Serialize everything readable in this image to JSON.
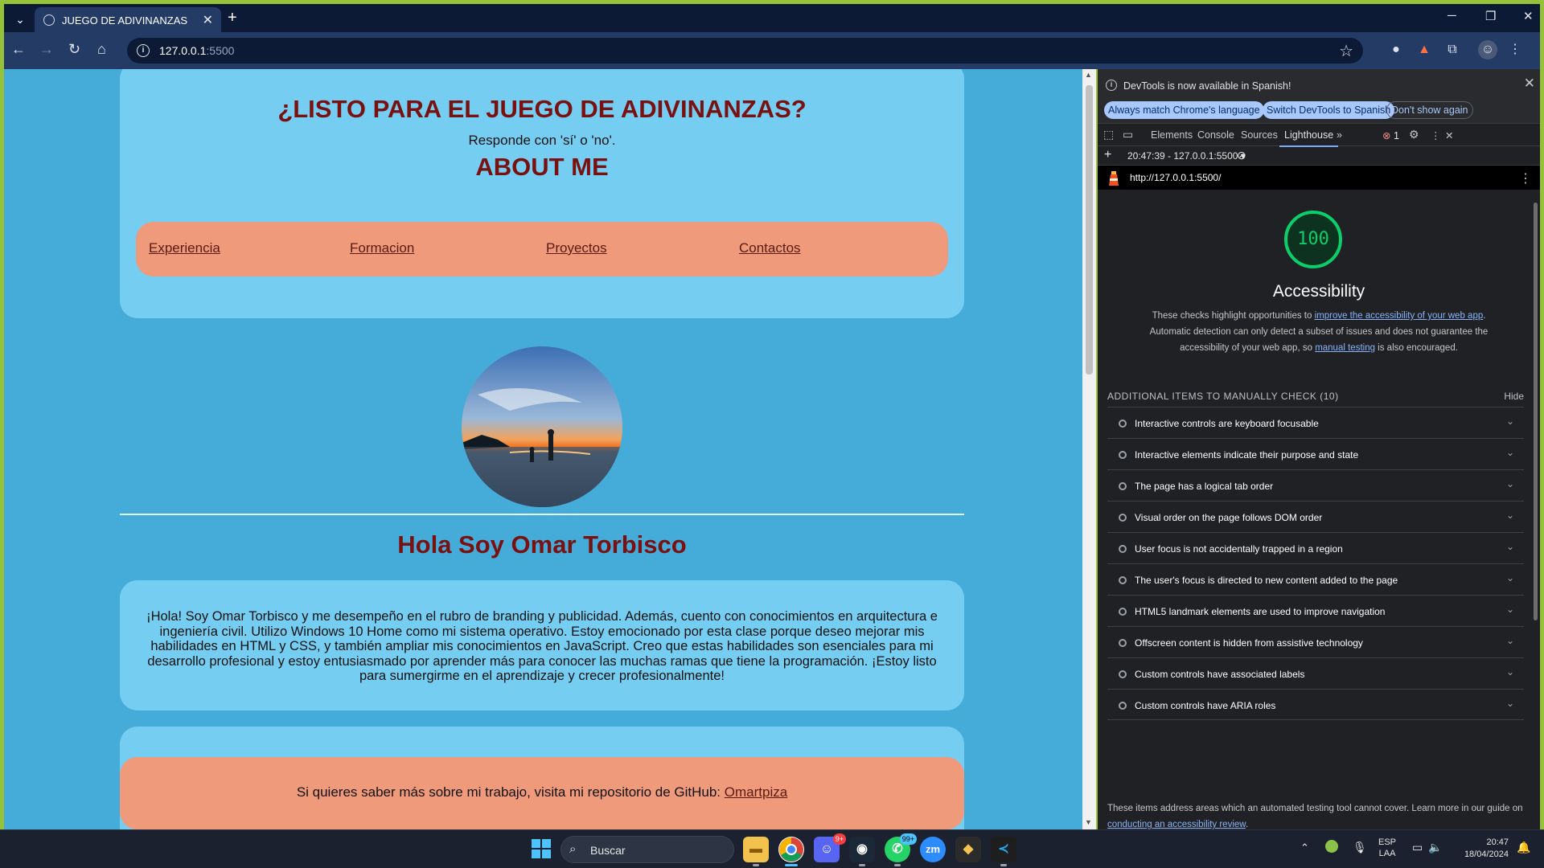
{
  "browser": {
    "tab_title": "JUEGO DE ADIVINANZAS",
    "url_host": "127.0.0.1",
    "url_port": ":5500"
  },
  "page": {
    "title": "¿LISTO PARA EL JUEGO DE ADIVINANZAS?",
    "subtitle": "Responde con 'sí' o 'no'.",
    "about_heading": "ABOUT ME",
    "nav": [
      "Experiencia",
      "Formacion",
      "Proyectos",
      "Contactos"
    ],
    "name_heading": "Hola Soy Omar Torbisco",
    "bio": "¡Hola! Soy Omar Torbisco y me desempeño en el rubro de branding y publicidad. Además, cuento con conocimientos en arquitectura e ingeniería civil. Utilizo Windows 10 Home como mi sistema operativo. Estoy emocionado por esta clase porque deseo mejorar mis habilidades en HTML y CSS, y también ampliar mis conocimientos en JavaScript. Creo que estas habilidades son esenciales para mi desarrollo profesional y estoy entusiasmado por aprender más para conocer las muchas ramas que tiene la programación. ¡Estoy listo para sumergirme en el aprendizaje y crecer profesionalmente!",
    "footer_text": "Si quieres saber más sobre mi trabajo, visita mi repositorio de GitHub: ",
    "footer_link": "Omartpiza"
  },
  "devtools": {
    "banner_text": "DevTools is now available in Spanish!",
    "banner_buttons": [
      "Always match Chrome's language",
      "Switch DevTools to Spanish",
      "Don't show again"
    ],
    "tabs": [
      "Elements",
      "Console",
      "Sources",
      "Lighthouse"
    ],
    "error_count": "1",
    "report_selector": "20:47:39 - 127.0.0.1:5500",
    "report_url": "http://127.0.0.1:5500/",
    "score": "100",
    "category": "Accessibility",
    "desc_1": "These checks highlight opportunities to ",
    "desc_link_1": "improve the accessibility of your web app",
    "desc_2": ". Automatic detection can only detect a subset of issues and does not guarantee the accessibility of your web app, so ",
    "desc_link_2": "manual testing",
    "desc_3": " is also encouraged.",
    "manual_header": "ADDITIONAL ITEMS TO MANUALLY CHECK (10)",
    "hide_label": "Hide",
    "audits": [
      "Interactive controls are keyboard focusable",
      "Interactive elements indicate their purpose and state",
      "The page has a logical tab order",
      "Visual order on the page follows DOM order",
      "User focus is not accidentally trapped in a region",
      "The user's focus is directed to new content added to the page",
      "HTML5 landmark elements are used to improve navigation",
      "Offscreen content is hidden from assistive technology",
      "Custom controls have associated labels",
      "Custom controls have ARIA roles"
    ],
    "footer_1": "These items address areas which an automated testing tool cannot cover. Learn more in our guide on ",
    "footer_link": "conducting an accessibility review",
    "footer_2": "."
  },
  "taskbar": {
    "search_label": "Buscar",
    "discord_badge": "9+",
    "whatsapp_badge": "99+",
    "zoom_label": "zm",
    "lang_1": "ESP",
    "lang_2": "LAA",
    "time": "20:47",
    "date": "18/04/2024"
  },
  "colors": {
    "page_bg": "#45acd9",
    "card_bg": "#75cdf1",
    "nav_bg": "#f09a7c",
    "heading": "#7a1111",
    "lighthouse_pass": "#0cce6b"
  }
}
